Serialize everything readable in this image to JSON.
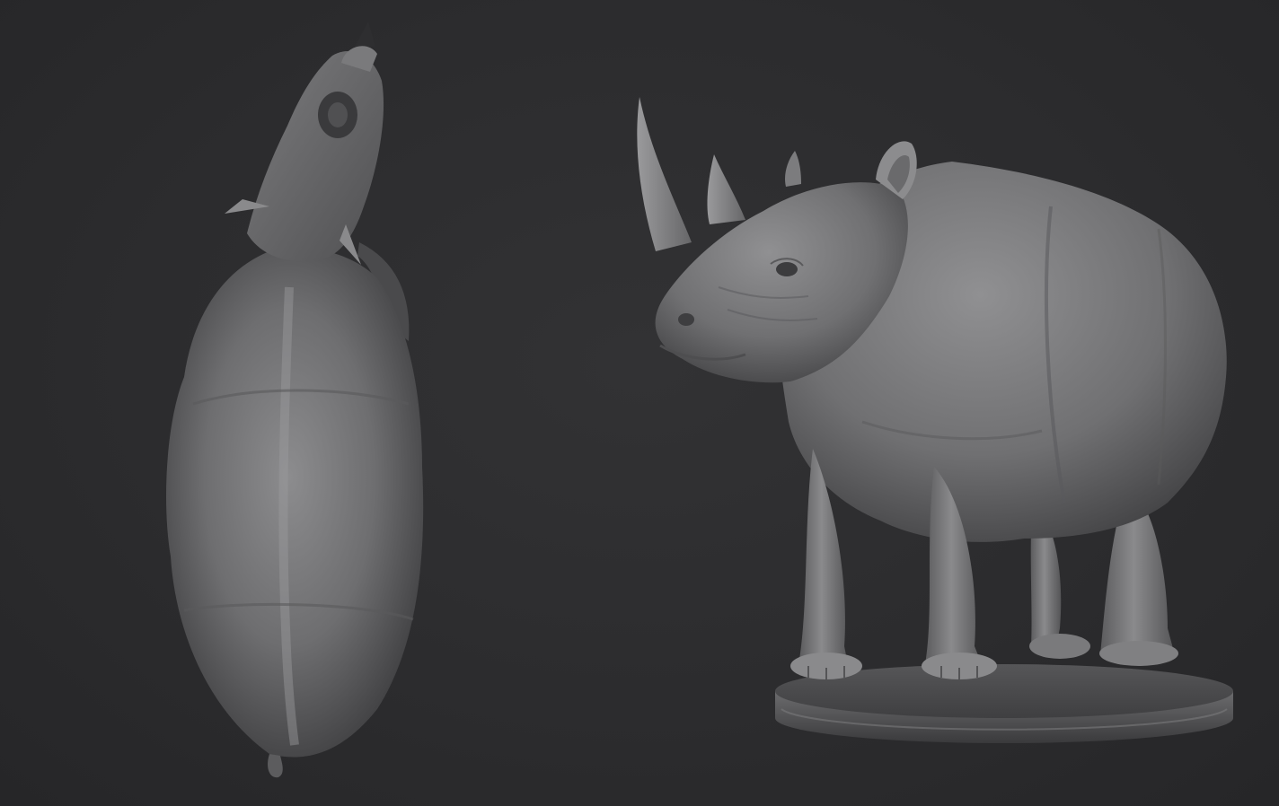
{
  "scene": {
    "background_color": "#2c2c2e",
    "material_color": "#8a8a8c",
    "objects": [
      {
        "name": "rhino-top-view",
        "view": "top"
      },
      {
        "name": "rhino-side-view-on-base",
        "view": "three-quarter"
      }
    ]
  }
}
